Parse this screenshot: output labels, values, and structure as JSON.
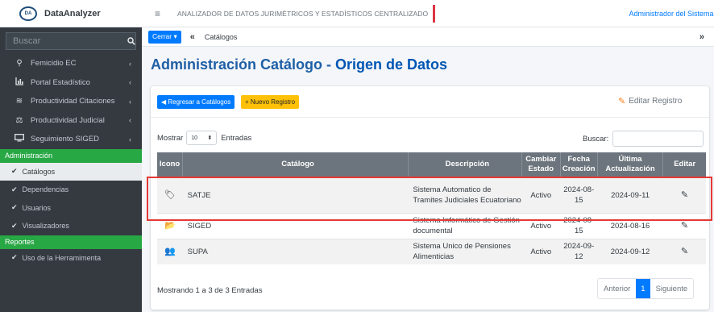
{
  "brand": {
    "name": "DataAnalyzer",
    "logo_text": "DA"
  },
  "sidebar": {
    "search_placeholder": "Buscar",
    "search_icon": "magnifier-icon",
    "items": [
      {
        "label": "Femicidio EC",
        "icon": "⚲"
      },
      {
        "label": "Portal Estadístico",
        "icon": "📊"
      },
      {
        "label": "Productividad Citaciones",
        "icon": "≋"
      },
      {
        "label": "Productividad Judicial",
        "icon": "⚖"
      },
      {
        "label": "Seguimiento SIGED",
        "icon": "▭"
      }
    ],
    "chevron": "‹",
    "section_admin": "Administración",
    "admin_items": [
      "Catálogos",
      "Dependencias",
      "Usuarios",
      "Visualizadores"
    ],
    "section_reportes": "Reportes",
    "reportes_items": [
      "Uso de la Herramimenta"
    ],
    "check_glyph": "✔"
  },
  "topbar": {
    "menu_glyph": "≡",
    "title": "ANALIZADOR DE DATOS JURIMÉTRICOS Y ESTADÍSTICOS CENTRALIZADO",
    "user": "Administrador del Sistema V"
  },
  "breadcrumb": {
    "cerrar": "Cerrar ▾",
    "collapse_glyph": "«",
    "current": "Catálogos",
    "expand_glyph": "»"
  },
  "page": {
    "title_prefix": "Administración Catálogo - ",
    "title_bold": "Origen de Datos"
  },
  "actions": {
    "back": "◀ Regresar a Catálogos",
    "new": "+ Nuevo Registro",
    "edit_icon": "✎",
    "edit": "Editar Registro"
  },
  "table_controls": {
    "show_label": "Mostrar",
    "page_len": "10",
    "entries_label": "Entradas",
    "search_label": "Buscar:"
  },
  "table": {
    "headers": [
      "Icono",
      "Catálogo",
      "Descripción",
      "Cambiar Estado",
      "Fecha Creación",
      "Última Actualización",
      "Editar"
    ],
    "rows": [
      {
        "icon": "🏷",
        "catalogo": "SATJE",
        "descripcion": "Sistema Automatico de Tramites Judiciales Ecuatoriano",
        "estado": "Activo",
        "fecha": "2024-08-15",
        "actualizacion": "2024-09-11",
        "edit": "✎"
      },
      {
        "icon": "📂",
        "catalogo": "SIGED",
        "descripcion": "Sistema Informático de Gestión documental",
        "estado": "Activo",
        "fecha": "2024-08-15",
        "actualizacion": "2024-08-16",
        "edit": "✎"
      },
      {
        "icon": "👥",
        "catalogo": "SUPA",
        "descripcion": "Sistema Unico de Pensiones Alimenticias",
        "estado": "Activo",
        "fecha": "2024-09-12",
        "actualizacion": "2024-09-12",
        "edit": "✎"
      }
    ]
  },
  "footer": {
    "showing": "Mostrando 1 a 3 de 3 Entradas",
    "prev": "Anterior",
    "current_page": "1",
    "next": "Siguiente"
  },
  "colors": {
    "primary": "#007bff",
    "success": "#28a745",
    "warning": "#ffc107",
    "sidebar": "#343a40",
    "highlight": "#e53935"
  }
}
